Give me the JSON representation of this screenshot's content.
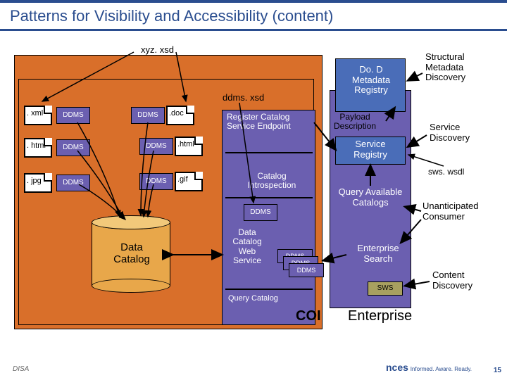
{
  "title": "Patterns for Visibility and Accessibility (content)",
  "files": {
    "xml": ". xml",
    "html": ". html",
    "jpg": ". jpg",
    "doc": ".doc",
    "html2": ".html",
    "gif": ".gif"
  },
  "ddms_label": "DDMS",
  "sws_label": "SWS",
  "schemas": {
    "xyz": "xyz. xsd",
    "ddms": "ddms. xsd",
    "sws": "sws. wsdl"
  },
  "labels": {
    "data_catalog": "Data Catalog",
    "register_endpoint": "Register Catalog Service Endpoint",
    "catalog_introspection": "Catalog Introspection",
    "data_catalog_ws": "Data Catalog Web Service",
    "query_catalog": "Query Catalog",
    "dod_registry": "Do. D Metadata Registry",
    "payload_desc": "Payload Description",
    "service_registry": "Service Registry",
    "query_catalogs": "Query Available Catalogs",
    "enterprise_search": "Enterprise Search",
    "structural_md": "Structural Metadata Discovery",
    "service_discovery": "Service Discovery",
    "unanticipated": "Unanticipated Consumer",
    "content_discovery": "Content Discovery",
    "coi": "COI",
    "enterprise": "Enterprise"
  },
  "footer": {
    "left": "DISA",
    "right_brand": "nces",
    "right_tag": "Informed. Aware. Ready.",
    "page": "15"
  }
}
